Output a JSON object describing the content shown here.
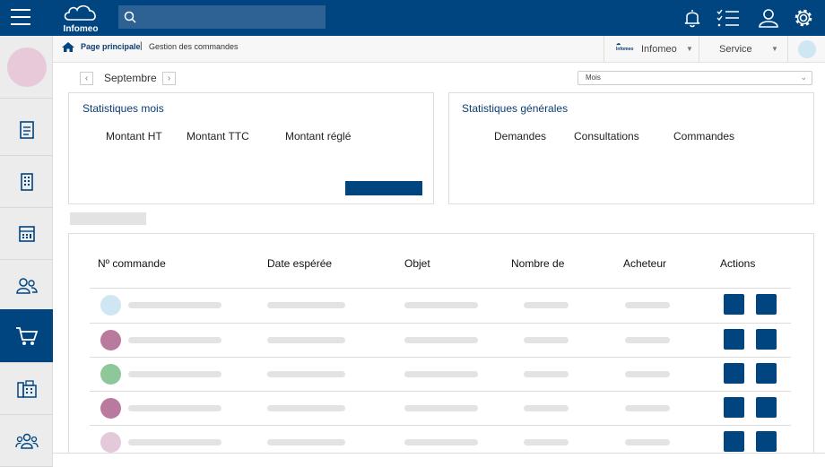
{
  "header": {
    "logo_text": "Infomeo",
    "search_placeholder": "",
    "icons": [
      "menu-icon",
      "search-icon",
      "bell-icon",
      "checklist-icon",
      "user-icon",
      "gear-icon"
    ]
  },
  "breadcrumb": {
    "home": "Page principale",
    "separator": "|",
    "current": "Gestion des commandes"
  },
  "topright": {
    "org": "Infomeo",
    "service": "Service"
  },
  "period": {
    "month": "Septembre",
    "select": "Mois"
  },
  "stats_month": {
    "title": "Statistiques mois",
    "labels": [
      "Montant HT",
      "Montant TTC",
      "Montant réglé"
    ]
  },
  "stats_general": {
    "title": "Statistiques générales",
    "labels": [
      "Demandes",
      "Consultations",
      "Commandes"
    ]
  },
  "table": {
    "headers": [
      "Nº commande",
      "Date espérée",
      "Objet",
      "Nombre de",
      "Acheteur",
      "Actions"
    ],
    "row_colors": [
      "#cfe6f3",
      "#b97a9e",
      "#8ec79a",
      "#b97a9e",
      "#e3c9da"
    ]
  },
  "colors": {
    "primary": "#004580",
    "avatar": "#e8c9d9"
  }
}
